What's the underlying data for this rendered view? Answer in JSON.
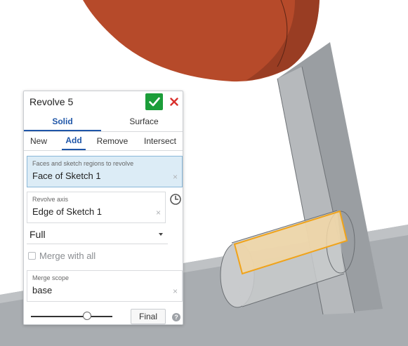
{
  "panel": {
    "title": "Revolve 5",
    "type_tabs": [
      "Solid",
      "Surface"
    ],
    "op_tabs": [
      "New",
      "Add",
      "Remove",
      "Intersect"
    ],
    "selection": {
      "label": "Faces and sketch regions to revolve",
      "value": "Face of Sketch 1"
    },
    "axis": {
      "label": "Revolve axis",
      "value": "Edge of Sketch 1"
    },
    "revolve_type": "Full",
    "merge_all_label": "Merge with all",
    "merge_scope": {
      "label": "Merge scope",
      "value": "base"
    },
    "final_label": "Final",
    "clear_glyph": "×",
    "help_glyph": "?"
  },
  "icons": {
    "accept": "checkmark-icon",
    "cancel": "close-icon",
    "axis_direction": "clock-icon",
    "help": "help-icon"
  },
  "colors": {
    "accept_button": "#1b9d39",
    "cancel_icon": "#d9302c",
    "selection_fill": "#dcecf6",
    "active_tab": "#1f56a8",
    "selection_highlight": "#f0a31a"
  }
}
